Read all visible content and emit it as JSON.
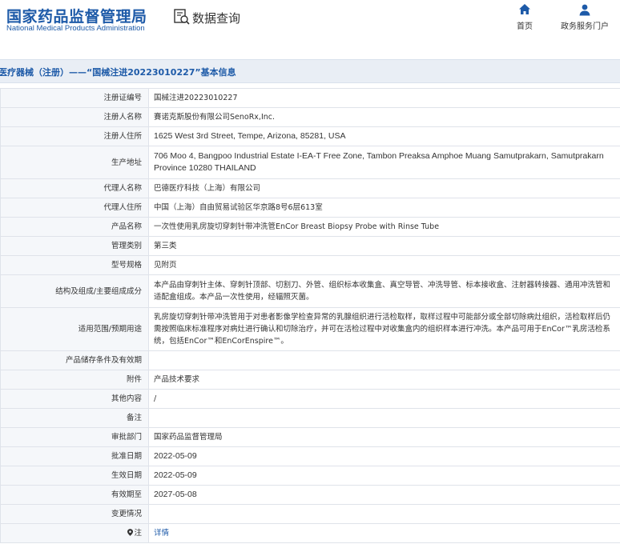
{
  "header": {
    "brand_cn": "国家药品监督管理局",
    "brand_en": "National Medical Products Administration",
    "query_label": "数据查询",
    "nav_home": "首页",
    "nav_portal": "政务服务门户"
  },
  "breadcrumb": "医疗器械（注册）——“国械注进20223010227”基本信息",
  "colors": {
    "brand": "#1d5aa8",
    "key_bg": "#f5f7fa",
    "border": "#dfe3ea"
  },
  "rows": [
    {
      "key": "注册证编号",
      "value": "国械注进20223010227"
    },
    {
      "key": "注册人名称",
      "value": "賽诺克斯股份有限公司SenoRx,Inc."
    },
    {
      "key": "注册人住所",
      "value": "1625 West 3rd Street, Tempe, Arizona, 85281, USA"
    },
    {
      "key": "生产地址",
      "value": "706 Moo 4, Bangpoo Industrial Estate I-EA-T Free Zone, Tambon Preaksa Amphoe Muang Samutprakarn, Samutprakarn Province 10280 THAILAND"
    },
    {
      "key": "代理人名称",
      "value": "巴德医疗科技（上海）有限公司"
    },
    {
      "key": "代理人住所",
      "value": "中国（上海）自由贸易试验区华京路8号6层613室"
    },
    {
      "key": "产品名称",
      "value": "一次性使用乳房旋切穿刺针带冲洗管EnCor Breast Biopsy Probe with Rinse Tube"
    },
    {
      "key": "管理类别",
      "value": "第三类"
    },
    {
      "key": "型号规格",
      "value": "见附页"
    },
    {
      "key": "结构及组成/主要组成成分",
      "value": "本产品由穿刺针主体、穿刺针顶部、切割刀、外管、组织标本收集盒、真空导管、冲洗导管、标本接收盒、注射器转接器、通用冲洗管和适配盒组成。本产品一次性使用，经辐照灭菌。"
    },
    {
      "key": "适用范围/预期用途",
      "value": "乳房旋切穿刺针带冲洗管用于对患者影像学检查异常的乳腺组织进行活检取样，取样过程中可能部分或全部切除病灶组织，活检取样后仍需按照临床标准程序对病灶进行确认和切除治疗，并可在活检过程中对收集盒内的组织样本进行冲洗。本产品可用于EnCor™乳房活检系统，包括EnCor™和EnCorEnspire™。"
    },
    {
      "key": "产品储存条件及有效期",
      "value": ""
    },
    {
      "key": "附件",
      "value": "产品技术要求"
    },
    {
      "key": "其他内容",
      "value": "/"
    },
    {
      "key": "备注",
      "value": ""
    },
    {
      "key": "审批部门",
      "value": "国家药品监督管理局"
    },
    {
      "key": "批准日期",
      "value": "2022-05-09"
    },
    {
      "key": "生效日期",
      "value": "2022-05-09"
    },
    {
      "key": "有效期至",
      "value": "2027-05-08"
    },
    {
      "key": "变更情况",
      "value": ""
    }
  ],
  "note": {
    "key": "注",
    "link": "详情",
    "icon": "location-pin-icon"
  }
}
